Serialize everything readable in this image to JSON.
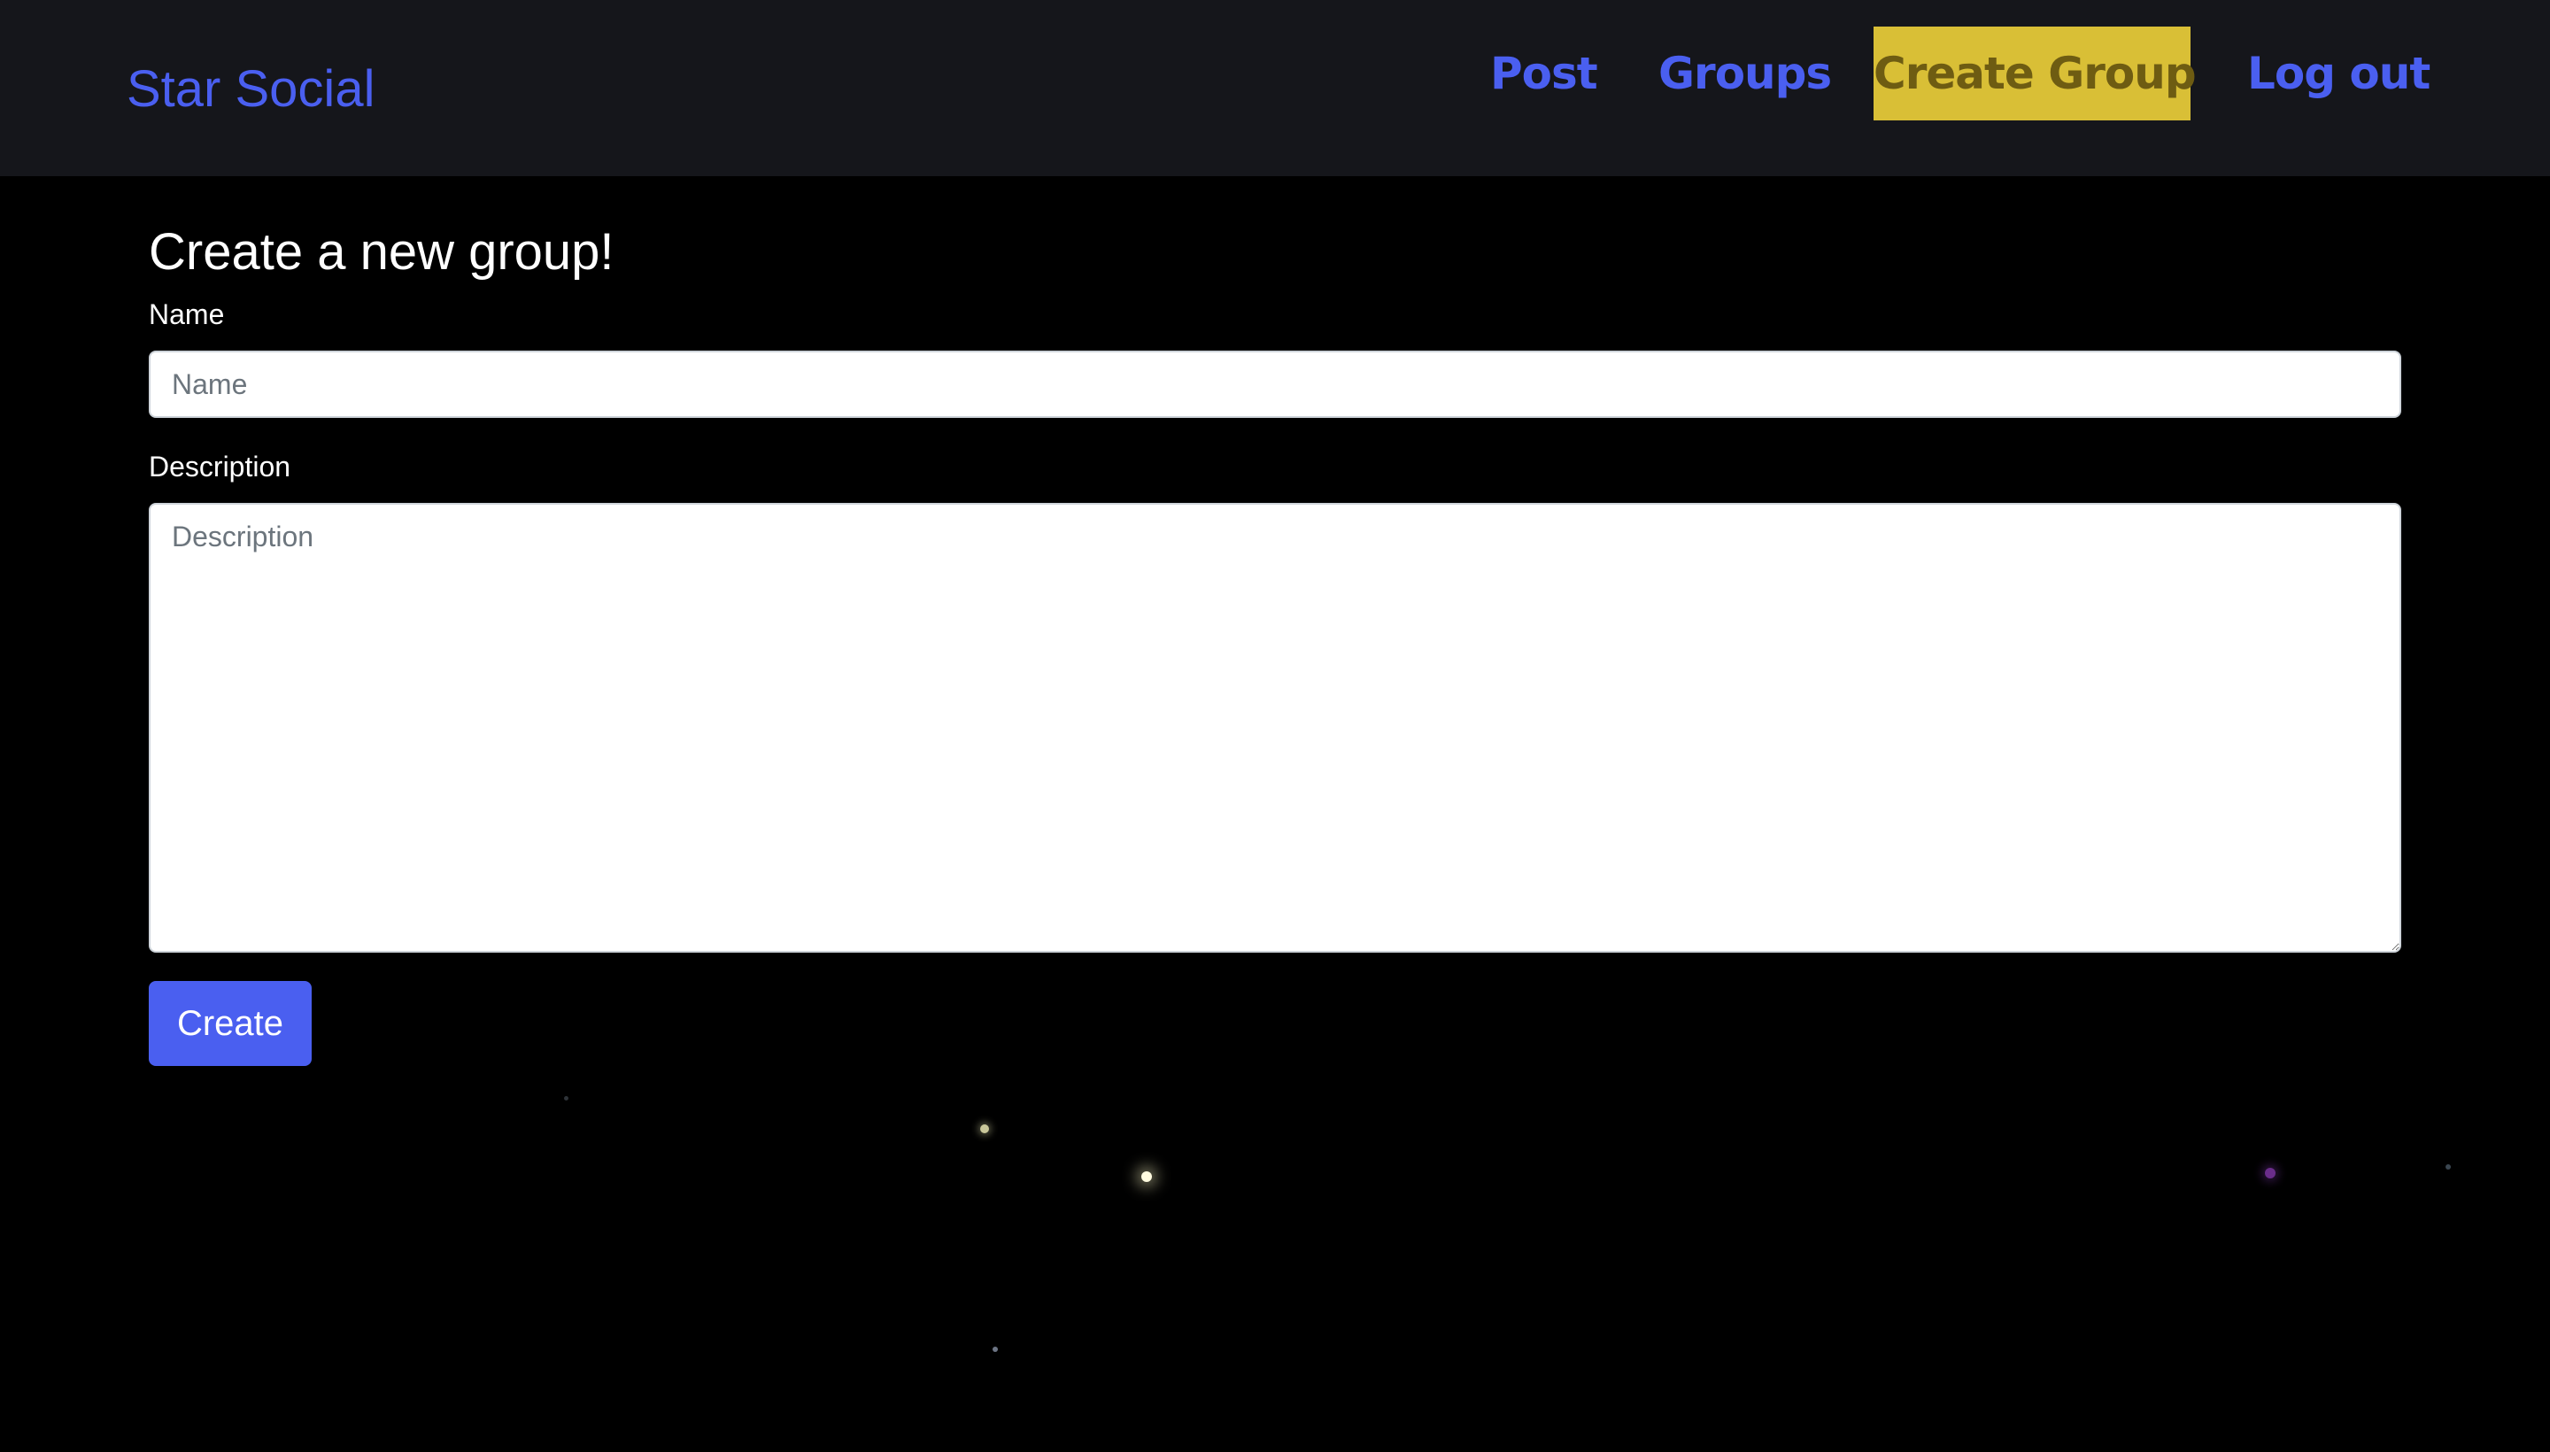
{
  "navbar": {
    "brand": "Star Social",
    "links": {
      "post": "Post",
      "groups": "Groups",
      "create_group": "Create Group",
      "logout": "Log out"
    },
    "active_link": "Create Group"
  },
  "form": {
    "heading": "Create a new group!",
    "name_label": "Name",
    "name_placeholder": "Name",
    "name_value": "",
    "description_label": "Description",
    "description_placeholder": "Description",
    "description_value": "",
    "submit_label": "Create"
  },
  "colors": {
    "page_background": "#000000",
    "navbar_background": "#15161b",
    "accent": "#4a5ff0",
    "active_link_background": "#d9bf36",
    "active_link_text": "#6e5c12"
  }
}
